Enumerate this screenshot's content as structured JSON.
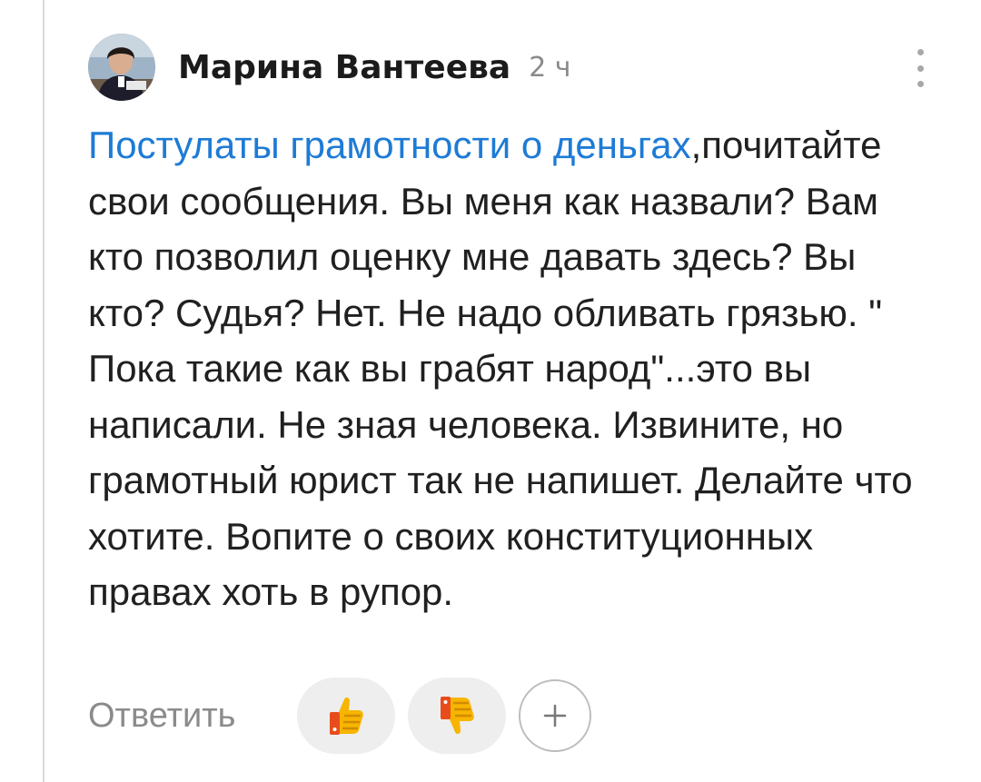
{
  "comment": {
    "author": "Марина Вантеева",
    "time": "2 ч",
    "mention": "Постулаты грамотности о деньгах",
    "body": ",почитайте свои сообщения. Вы меня как назвали? Вам кто позволил оценку мне давать здесь? Вы кто? Судья? Нет. Не надо обливать грязью. \" Пока такие как вы грабят народ\"...это вы написали. Не зная человека. Извините, но грамотный юрист так не напишет. Делайте что хотите. Вопите о своих конституционных правах хоть в рупор.",
    "icons": {
      "avatar": "user-avatar-photo",
      "menu": "more-vertical-icon",
      "like": "thumbs-up-icon",
      "dislike": "thumbs-down-icon",
      "add": "plus-icon"
    }
  },
  "actions": {
    "reply_label": "Ответить"
  },
  "colors": {
    "accent": "#1e7bd6",
    "text": "#202020",
    "muted": "#8b8b8b",
    "thread_line": "#d9d9d9",
    "reaction_bg": "#eeeeee"
  }
}
